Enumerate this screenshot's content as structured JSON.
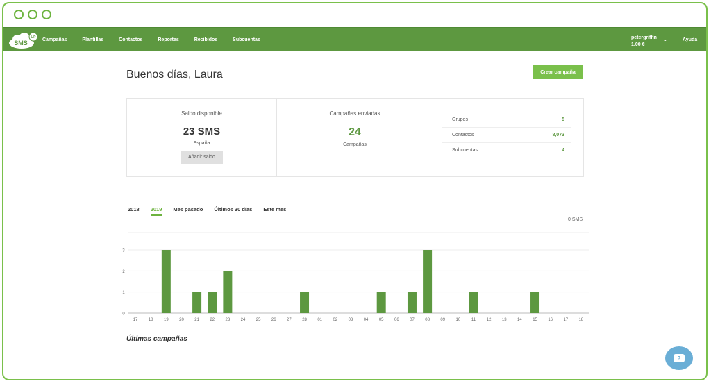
{
  "nav": {
    "logo_text": "SMS",
    "logo_badge": "UP",
    "items": [
      {
        "label": "Campañas"
      },
      {
        "label": "Plantillas"
      },
      {
        "label": "Contactos"
      },
      {
        "label": "Reportes"
      },
      {
        "label": "Recibidos"
      },
      {
        "label": "Subcuentas"
      }
    ],
    "user_name": "petergriffin",
    "user_balance": "1.00 €",
    "help_label": "Ayuda"
  },
  "header": {
    "greeting": "Buenos días, Laura",
    "create_button": "Crear campaña"
  },
  "stats": {
    "balance": {
      "title": "Saldo disponible",
      "value": "23 SMS",
      "country": "España",
      "add_button": "Añadir saldo"
    },
    "campaigns": {
      "title": "Campañas enviadas",
      "value": "24",
      "sub": "Campañas"
    },
    "summary": [
      {
        "label": "Grupos",
        "value": "5"
      },
      {
        "label": "Contactos",
        "value": "8,073"
      },
      {
        "label": "Subcuentas",
        "value": "4"
      }
    ]
  },
  "filters": [
    {
      "label": "2018",
      "active": false
    },
    {
      "label": "2019",
      "active": true
    },
    {
      "label": "Mes pasado",
      "active": false
    },
    {
      "label": "Últimos 30 días",
      "active": false
    },
    {
      "label": "Este mes",
      "active": false
    }
  ],
  "sms_total": "0 SMS",
  "colors": {
    "brand": "#5d9840",
    "accent": "#7ac04b",
    "bar": "#5d9840",
    "chat": "#6aaed6"
  },
  "chart_data": {
    "type": "bar",
    "categories": [
      "17",
      "18",
      "19",
      "20",
      "21",
      "22",
      "23",
      "24",
      "25",
      "26",
      "27",
      "28",
      "01",
      "02",
      "03",
      "04",
      "05",
      "06",
      "07",
      "08",
      "09",
      "10",
      "11",
      "12",
      "13",
      "14",
      "15",
      "16",
      "17",
      "18"
    ],
    "values": [
      0,
      0,
      3,
      0,
      1,
      1,
      2,
      0,
      0,
      0,
      0,
      1,
      0,
      0,
      0,
      0,
      1,
      0,
      1,
      3,
      0,
      0,
      1,
      0,
      0,
      0,
      1,
      0,
      0,
      0
    ],
    "yticks": [
      "0",
      "1",
      "2",
      "3"
    ],
    "ylim": [
      0,
      3
    ]
  },
  "recent": {
    "title": "Últimas campañas"
  },
  "chat": {
    "icon": "chat-icon",
    "symbol": "?"
  }
}
